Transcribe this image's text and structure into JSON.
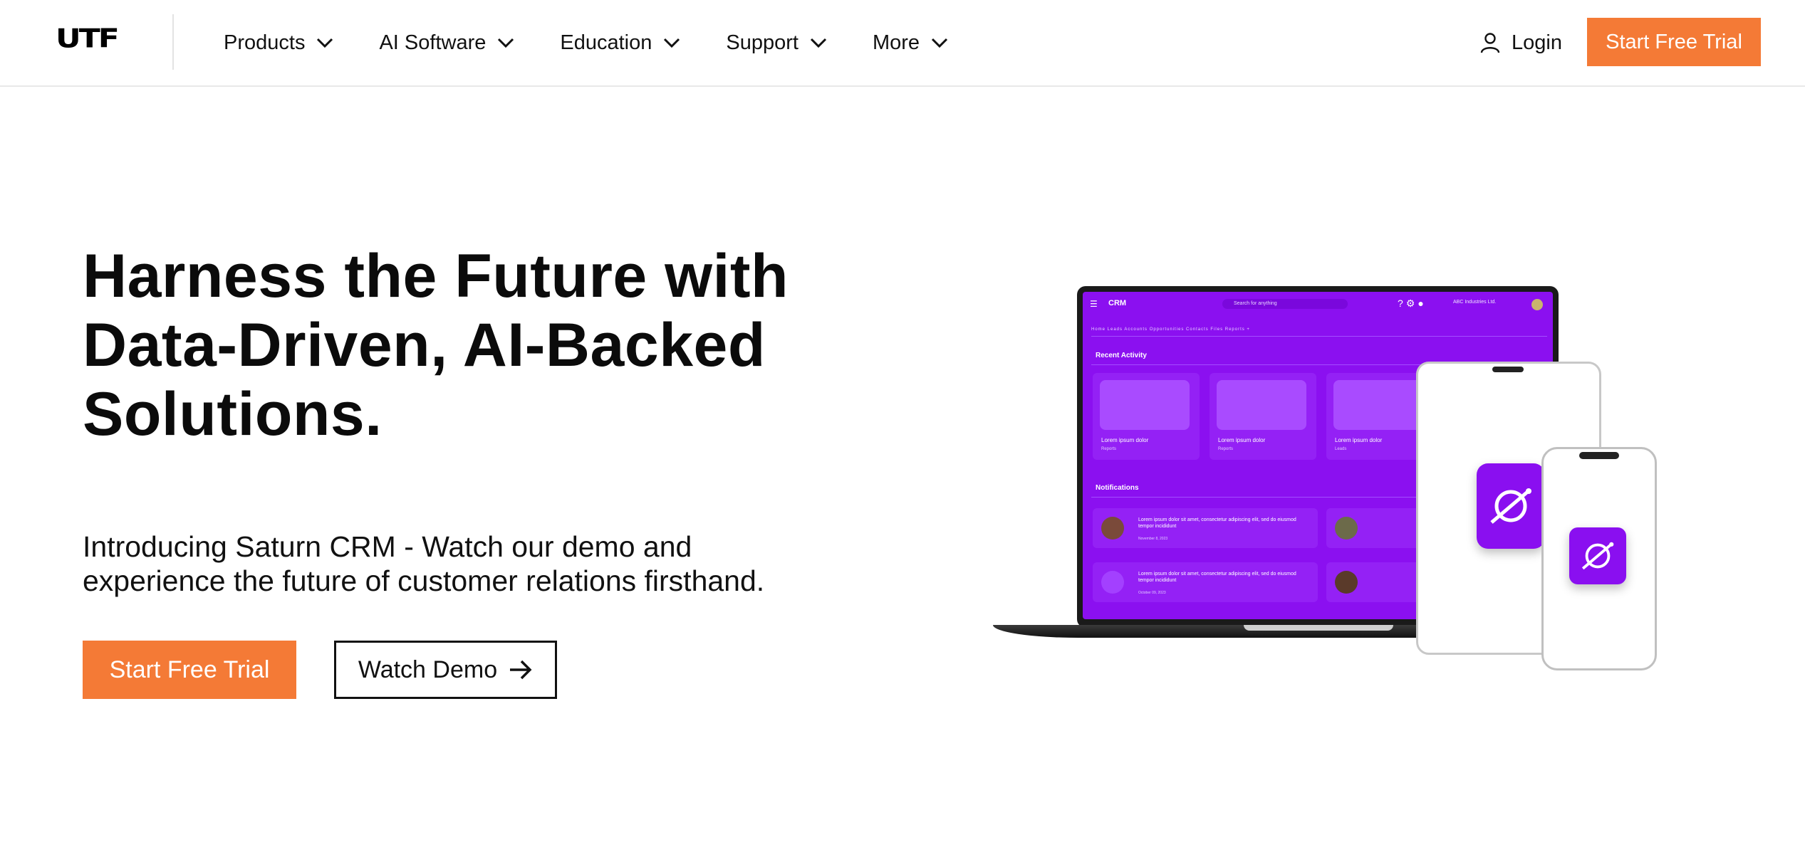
{
  "nav": {
    "logo": "UTF",
    "menu": [
      {
        "label": "Products"
      },
      {
        "label": "AI Software"
      },
      {
        "label": "Education"
      },
      {
        "label": "Support"
      },
      {
        "label": "More"
      }
    ],
    "login_label": "Login",
    "cta_label": "Start Free Trial"
  },
  "hero": {
    "title_lines": [
      "Harness the Future with",
      "Data-Driven, AI-Backed",
      "Solutions."
    ],
    "subtitle_lines": [
      "Introducing Saturn CRM - Watch our demo and",
      "experience the future of customer relations firsthand."
    ],
    "primary_cta": "Start Free Trial",
    "secondary_cta": "Watch Demo"
  },
  "illustration": {
    "crm_logo": "CRM",
    "search_placeholder": "Search for anything",
    "company": "ABC Industries Ltd.",
    "tabs": "Home   Leads   Accounts   Opportunities   Contacts   Files   Reports   +",
    "recent_activity": "Recent Activity",
    "notifications": "Notifications",
    "cards": [
      {
        "label": "Lorem ipsum dolor",
        "sub": "Reports"
      },
      {
        "label": "Lorem ipsum dolor",
        "sub": "Reports"
      },
      {
        "label": "Lorem ipsum dolor",
        "sub": "Leads"
      }
    ],
    "notes": [
      {
        "text": "Lorem ipsum dolor sit amet, consectetur adipiscing elit, sed do eiusmod tempor incididunt",
        "date": "November 8, 2023"
      },
      {
        "text": "Lorem ipsum dolor sit amet, consectetur adipiscing elit, sed do eiusmod tempor incididunt",
        "date": "October 09, 2023"
      }
    ]
  },
  "colors": {
    "accent": "#f47a36",
    "crm_purple": "#8b10f0",
    "text": "#0b0b0b"
  }
}
